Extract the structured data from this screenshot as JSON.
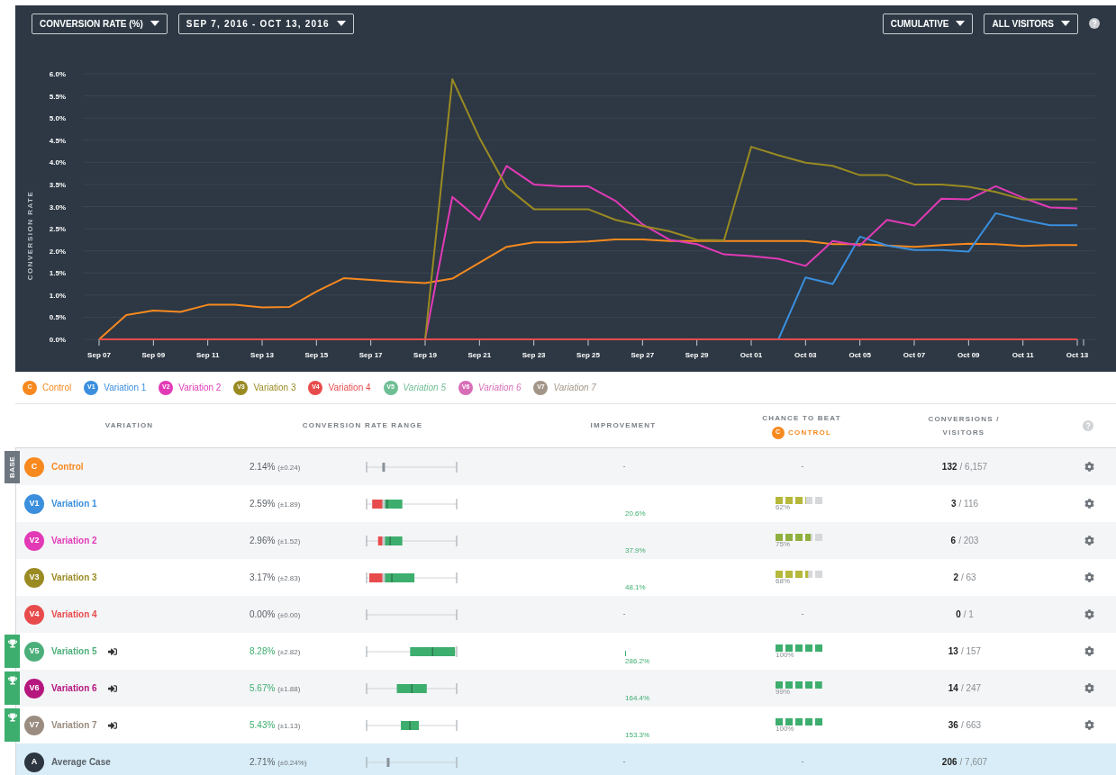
{
  "toolbar": {
    "metric": "CONVERSION RATE (%)",
    "date_range": "SEP 7, 2016 - OCT 13, 2016",
    "mode": "CUMULATIVE",
    "segment": "ALL VISITORS"
  },
  "chart": {
    "chart_data": {
      "type": "line",
      "grid": true,
      "ylabel": "CONVERSION RATE",
      "ylim": [
        0,
        6
      ],
      "yticks": [
        {
          "value": 0,
          "label": "0.0%"
        },
        {
          "value": 0.5,
          "label": "0.5%"
        },
        {
          "value": 1,
          "label": "1.0%"
        },
        {
          "value": 1.5,
          "label": "1.5%"
        },
        {
          "value": 2,
          "label": "2.0%"
        },
        {
          "value": 2.5,
          "label": "2.5%"
        },
        {
          "value": 3,
          "label": "3.0%"
        },
        {
          "value": 3.5,
          "label": "3.5%"
        },
        {
          "value": 4,
          "label": "4.0%"
        },
        {
          "value": 4.5,
          "label": "4.5%"
        },
        {
          "value": 5,
          "label": "5.0%"
        },
        {
          "value": 5.5,
          "label": "5.5%"
        },
        {
          "value": 6,
          "label": "6.0%"
        }
      ],
      "categories": [
        "Sep 07",
        null,
        "Sep 09",
        null,
        "Sep 11",
        null,
        "Sep 13",
        null,
        "Sep 15",
        null,
        "Sep 17",
        null,
        "Sep 19",
        null,
        "Sep 21",
        null,
        "Sep 23",
        null,
        "Sep 25",
        null,
        "Sep 27",
        null,
        "Sep 29",
        null,
        "Oct 01",
        null,
        "Oct 03",
        null,
        "Oct 05",
        null,
        "Oct 07",
        null,
        "Oct 09",
        null,
        "Oct 11",
        null,
        "Oct 13"
      ],
      "series": [
        {
          "color": "#f7891f",
          "values": [
            0,
            0.55,
            0.65,
            0.62,
            0.78,
            0.78,
            0.72,
            0.73,
            1.08,
            1.38,
            1.34,
            1.3,
            1.27,
            1.37,
            1.73,
            2.09,
            2.19,
            2.19,
            2.21,
            2.26,
            2.26,
            2.22,
            2.22,
            2.22,
            2.22,
            2.22,
            2.22,
            2.15,
            2.15,
            2.12,
            2.09,
            2.13,
            2.16,
            2.15,
            2.11,
            2.13,
            2.13
          ]
        },
        {
          "color": "#3b8fdd",
          "values": [
            null,
            null,
            null,
            null,
            null,
            null,
            null,
            null,
            null,
            null,
            null,
            null,
            null,
            null,
            null,
            null,
            null,
            null,
            null,
            null,
            null,
            null,
            null,
            null,
            null,
            0,
            1.4,
            1.25,
            2.32,
            2.12,
            2.02,
            2.02,
            1.98,
            2.85,
            2.7,
            2.58,
            2.58
          ]
        },
        {
          "color": "#e23ab6",
          "values": [
            null,
            null,
            null,
            null,
            null,
            null,
            null,
            null,
            null,
            null,
            null,
            null,
            0,
            3.22,
            2.7,
            3.92,
            3.5,
            3.46,
            3.46,
            3.13,
            2.6,
            2.25,
            2.15,
            1.92,
            1.88,
            1.82,
            1.66,
            2.22,
            2.12,
            2.7,
            2.57,
            3.18,
            3.16,
            3.46,
            3.2,
            2.98,
            2.96
          ]
        },
        {
          "color": "#9a8a22",
          "values": [
            null,
            null,
            null,
            null,
            null,
            null,
            null,
            null,
            null,
            null,
            null,
            null,
            0,
            5.88,
            4.55,
            3.44,
            2.94,
            2.94,
            2.94,
            2.7,
            2.56,
            2.44,
            2.25,
            2.24,
            4.35,
            4.16,
            3.99,
            3.92,
            3.71,
            3.71,
            3.5,
            3.5,
            3.45,
            3.33,
            3.16,
            3.16,
            3.16
          ]
        },
        {
          "color": "#e84b4b",
          "values": [
            0,
            0,
            0,
            0,
            0,
            0,
            0,
            0,
            0,
            0,
            0,
            0,
            0,
            0,
            0,
            0,
            0,
            0,
            0,
            0,
            0,
            0,
            0,
            0,
            0,
            0,
            0,
            0,
            0,
            0,
            0,
            0,
            0,
            0,
            0,
            0,
            0
          ]
        }
      ]
    }
  },
  "legend": [
    {
      "badge": "C",
      "label": "Control",
      "color": "#f7891f",
      "visible": true
    },
    {
      "badge": "V1",
      "label": "Variation 1",
      "color": "#3b8fdd",
      "visible": true
    },
    {
      "badge": "V2",
      "label": "Variation 2",
      "color": "#e23ab6",
      "visible": true
    },
    {
      "badge": "V3",
      "label": "Variation 3",
      "color": "#9a8a22",
      "visible": true
    },
    {
      "badge": "V4",
      "label": "Variation 4",
      "color": "#e84b4b",
      "visible": true
    },
    {
      "badge": "V5",
      "label": "Variation 5",
      "color": "#6fbf94",
      "visible": false
    },
    {
      "badge": "V6",
      "label": "Variation 6",
      "color": "#d86db8",
      "visible": false
    },
    {
      "badge": "V7",
      "label": "Variation 7",
      "color": "#a39688",
      "visible": false
    }
  ],
  "table": {
    "columns": {
      "variation": "VARIATION",
      "range": "CONVERSION RATE RANGE",
      "improvement": "IMPROVEMENT",
      "chance_title": "CHANCE TO BEAT",
      "chance_badge": "C",
      "chance_target": "CONTROL",
      "conversions": "CONVERSIONS /",
      "visitors": "VISITORS"
    },
    "rows": [
      {
        "kind": "variation",
        "tag": "BASE",
        "winner": false,
        "badge": "C",
        "name": "Control",
        "color": "#f7891f",
        "rate": "2.14%",
        "margin": "(±0.24)",
        "improvement": "-",
        "improvement_marker": false,
        "chance": "-",
        "chance_meter": false,
        "conversions": "132",
        "visitors": "/ 6,157"
      },
      {
        "kind": "variation",
        "winner": false,
        "badge": "V1",
        "name": "Variation 1",
        "color": "#3b8fdd",
        "rate": "2.59%",
        "margin": "(±1.89)",
        "improvement": "20.6%",
        "improvement_marker": false,
        "chance": "62%",
        "chance_meter": true,
        "conversions": "3",
        "visitors": "/ 116"
      },
      {
        "kind": "variation",
        "winner": false,
        "badge": "V2",
        "name": "Variation 2",
        "color": "#e23ab6",
        "rate": "2.96%",
        "margin": "(±1.52)",
        "improvement": "37.9%",
        "improvement_marker": false,
        "chance": "75%",
        "chance_meter": true,
        "conversions": "6",
        "visitors": "/ 203"
      },
      {
        "kind": "variation",
        "winner": false,
        "badge": "V3",
        "name": "Variation 3",
        "color": "#9a8a22",
        "rate": "3.17%",
        "margin": "(±2.83)",
        "improvement": "48.1%",
        "improvement_marker": false,
        "chance": "68%",
        "chance_meter": true,
        "conversions": "2",
        "visitors": "/ 63"
      },
      {
        "kind": "variation",
        "winner": false,
        "badge": "V4",
        "name": "Variation 4",
        "color": "#e84b4b",
        "rate": "0.00%",
        "margin": "(±0.00)",
        "improvement": "-",
        "improvement_marker": false,
        "chance": "-",
        "chance_meter": false,
        "conversions": "0",
        "visitors": "/ 1"
      },
      {
        "kind": "variation",
        "winner": true,
        "badge": "V5",
        "name": "Variation 5",
        "color": "#4caf7a",
        "rate": "8.28%",
        "margin": "(±2.82)",
        "improvement": "286.2%",
        "improvement_marker": true,
        "chance": "100%",
        "chance_meter": true,
        "conversions": "13",
        "visitors": "/ 157"
      },
      {
        "kind": "variation",
        "winner": true,
        "badge": "V6",
        "name": "Variation 6",
        "color": "#b5177e",
        "rate": "5.67%",
        "margin": "(±1.88)",
        "improvement": "164.4%",
        "improvement_marker": false,
        "chance": "99%",
        "chance_meter": true,
        "conversions": "14",
        "visitors": "/ 247"
      },
      {
        "kind": "variation",
        "winner": true,
        "badge": "V7",
        "name": "Variation 7",
        "color": "#9a8c80",
        "rate": "5.43%",
        "margin": "(±1.13)",
        "improvement": "153.3%",
        "improvement_marker": false,
        "chance": "100%",
        "chance_meter": true,
        "conversions": "36",
        "visitors": "/ 663"
      },
      {
        "kind": "average",
        "winner": false,
        "badge": "A",
        "name": "Average Case",
        "color": "#2d3640",
        "rate": "2.71%",
        "margin": "(±0.24%)",
        "improvement": "-",
        "improvement_marker": false,
        "chance": "-",
        "chance_meter": false,
        "conversions": "206",
        "visitors": "/ 7,607"
      }
    ]
  }
}
